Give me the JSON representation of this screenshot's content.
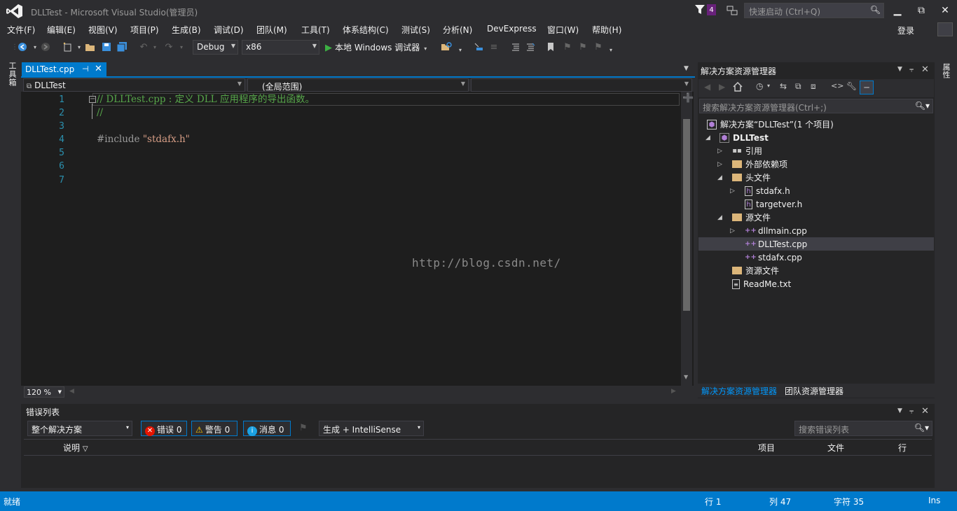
{
  "window": {
    "title": "DLLTest - Microsoft Visual Studio(管理员)",
    "notification_count": "4",
    "quick_launch_placeholder": "快速启动 (Ctrl+Q)",
    "login": "登录"
  },
  "menu": [
    "文件(F)",
    "编辑(E)",
    "视图(V)",
    "项目(P)",
    "生成(B)",
    "调试(D)",
    "团队(M)",
    "工具(T)",
    "体系结构(C)",
    "测试(S)",
    "分析(N)",
    "DevExpress",
    "窗口(W)",
    "帮助(H)"
  ],
  "toolbar": {
    "config": "Debug",
    "platform": "x86",
    "start_label": "本地 Windows 调试器"
  },
  "side_tabs": {
    "toolbox": "工具箱",
    "properties": "属性"
  },
  "editor": {
    "tab_label": "DLLTest.cpp",
    "nav_project": "DLLTest",
    "nav_scope": "(全局范围)",
    "nav_member": "",
    "line_numbers": [
      "1",
      "2",
      "3",
      "4",
      "5",
      "6",
      "7"
    ],
    "code": {
      "line1": "// DLLTest.cpp : 定义 DLL 应用程序的导出函数。",
      "line2": "//",
      "line4_directive": "#include ",
      "line4_string": "\"stdafx.h\""
    },
    "watermark": "http://blog.csdn.net/",
    "zoom": "120 %"
  },
  "solution_explorer": {
    "title": "解决方案资源管理器",
    "search_placeholder": "搜索解决方案资源管理器(Ctrl+;)",
    "items": [
      {
        "label": "解决方案“DLLTest”(1 个项目)"
      },
      {
        "label": "DLLTest"
      },
      {
        "label": "引用"
      },
      {
        "label": "外部依赖项"
      },
      {
        "label": "头文件"
      },
      {
        "label": "stdafx.h"
      },
      {
        "label": "targetver.h"
      },
      {
        "label": "源文件"
      },
      {
        "label": "dllmain.cpp"
      },
      {
        "label": "DLLTest.cpp"
      },
      {
        "label": "stdafx.cpp"
      },
      {
        "label": "资源文件"
      },
      {
        "label": "ReadMe.txt"
      }
    ],
    "tabs": [
      "解决方案资源管理器",
      "团队资源管理器"
    ]
  },
  "error_list": {
    "title": "错误列表",
    "scope": "整个解决方案",
    "errors": "错误 0",
    "warnings": "警告 0",
    "messages": "消息 0",
    "source": "生成 + IntelliSense",
    "search_placeholder": "搜索错误列表",
    "columns": [
      "说明",
      "项目",
      "文件",
      "行"
    ]
  },
  "status": {
    "ready": "就绪",
    "line": "行 1",
    "col": "列 47",
    "char": "字符 35",
    "mode": "Ins"
  },
  "colors": {
    "accent": "#007acc",
    "background": "#2d2d30",
    "editor_bg": "#1e1e1e",
    "comment": "#57a64a",
    "string": "#d69d85",
    "line_number": "#2b91af"
  }
}
